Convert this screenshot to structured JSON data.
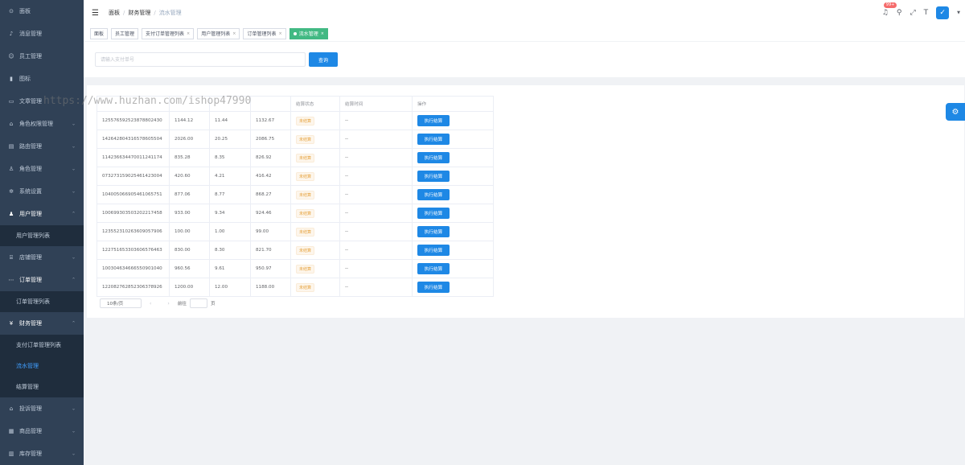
{
  "sidebar": {
    "items": [
      {
        "label": "面板",
        "icon": "dashboard-icon",
        "glyph": "⊙"
      },
      {
        "label": "消息管理",
        "icon": "bell-icon",
        "glyph": "🔔"
      },
      {
        "label": "员工管理",
        "icon": "user-group-icon",
        "glyph": "☺"
      },
      {
        "label": "图标",
        "icon": "icon-icon",
        "glyph": "▮"
      },
      {
        "label": "文章管理",
        "icon": "document-icon",
        "glyph": "▭"
      },
      {
        "label": "角色权限管理",
        "icon": "lock-icon",
        "glyph": "⌂"
      },
      {
        "label": "路由管理",
        "icon": "folder-icon",
        "glyph": "▤"
      },
      {
        "label": "角色管理",
        "icon": "person-icon",
        "glyph": "♙"
      },
      {
        "label": "系统设置",
        "icon": "gear-icon",
        "glyph": "✲"
      },
      {
        "label": "用户管理",
        "icon": "user-icon",
        "glyph": "♟"
      },
      {
        "label": "店铺管理",
        "icon": "shop-icon",
        "glyph": "⌸"
      },
      {
        "label": "订单管理",
        "icon": "order-icon",
        "glyph": "⋯"
      },
      {
        "label": "财务管理",
        "icon": "yen-icon",
        "glyph": "¥"
      },
      {
        "label": "投诉管理",
        "icon": "complaint-icon",
        "glyph": "⌂"
      },
      {
        "label": "商品管理",
        "icon": "goods-icon",
        "glyph": "▦"
      },
      {
        "label": "库存管理",
        "icon": "stock-icon",
        "glyph": "▥"
      }
    ],
    "user_sub": [
      "用户管理列表"
    ],
    "order_sub": [
      "订单管理列表"
    ],
    "finance_sub": [
      "支付订单管理列表",
      "流水管理",
      "结算管理"
    ]
  },
  "navbar": {
    "breadcrumb": [
      "面板",
      "财务管理",
      "流水管理"
    ],
    "badge": "99+"
  },
  "tags": [
    "面板",
    "员工管理",
    "支付订单管理列表",
    "用户管理列表",
    "订单管理列表",
    "流水管理"
  ],
  "search": {
    "placeholder": "请输入支付单号",
    "button": "查询"
  },
  "table": {
    "headers": [
      "",
      "",
      "",
      "",
      "结算状态",
      "结算时间",
      "操作"
    ],
    "rows": [
      [
        "125576592523878802430",
        "1144.12",
        "11.44",
        "1132.67",
        "未结算",
        "--",
        "执行结算"
      ],
      [
        "142642804316578605504",
        "2026.00",
        "20.25",
        "2086.75",
        "未结算",
        "--",
        "执行结算"
      ],
      [
        "114236634470011241174",
        "835.28",
        "8.35",
        "826.92",
        "未结算",
        "--",
        "执行结算"
      ],
      [
        "073273159025461423004",
        "420.60",
        "4.21",
        "416.42",
        "未结算",
        "--",
        "执行结算"
      ],
      [
        "104005066905461065751",
        "877.06",
        "8.77",
        "868.27",
        "未结算",
        "--",
        "执行结算"
      ],
      [
        "100699303503202217458",
        "933.00",
        "9.34",
        "924.46",
        "未结算",
        "--",
        "执行结算"
      ],
      [
        "123552310263609057906",
        "100.00",
        "1.00",
        "99.00",
        "未结算",
        "--",
        "执行结算"
      ],
      [
        "122751653303606576463",
        "830.00",
        "8.30",
        "821.70",
        "未结算",
        "--",
        "执行结算"
      ],
      [
        "100304634666550901040",
        "960.56",
        "9.61",
        "950.97",
        "未结算",
        "--",
        "执行结算"
      ],
      [
        "122082762852306378926",
        "1200.00",
        "12.00",
        "1188.00",
        "未结算",
        "--",
        "执行结算"
      ]
    ]
  },
  "pagination": {
    "page_size": "10条/页",
    "goto_label": "前往",
    "page_unit": "页"
  },
  "watermark": "https://www.huzhan.com/ishop47990"
}
